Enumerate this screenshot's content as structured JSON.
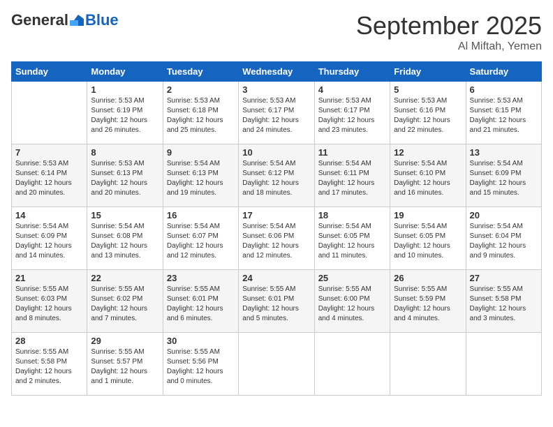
{
  "logo": {
    "general": "General",
    "blue": "Blue"
  },
  "header": {
    "month": "September 2025",
    "location": "Al Miftah, Yemen"
  },
  "weekdays": [
    "Sunday",
    "Monday",
    "Tuesday",
    "Wednesday",
    "Thursday",
    "Friday",
    "Saturday"
  ],
  "weeks": [
    [
      {
        "day": null
      },
      {
        "day": 1,
        "sunrise": "Sunrise: 5:53 AM",
        "sunset": "Sunset: 6:19 PM",
        "daylight": "Daylight: 12 hours and 26 minutes."
      },
      {
        "day": 2,
        "sunrise": "Sunrise: 5:53 AM",
        "sunset": "Sunset: 6:18 PM",
        "daylight": "Daylight: 12 hours and 25 minutes."
      },
      {
        "day": 3,
        "sunrise": "Sunrise: 5:53 AM",
        "sunset": "Sunset: 6:17 PM",
        "daylight": "Daylight: 12 hours and 24 minutes."
      },
      {
        "day": 4,
        "sunrise": "Sunrise: 5:53 AM",
        "sunset": "Sunset: 6:17 PM",
        "daylight": "Daylight: 12 hours and 23 minutes."
      },
      {
        "day": 5,
        "sunrise": "Sunrise: 5:53 AM",
        "sunset": "Sunset: 6:16 PM",
        "daylight": "Daylight: 12 hours and 22 minutes."
      },
      {
        "day": 6,
        "sunrise": "Sunrise: 5:53 AM",
        "sunset": "Sunset: 6:15 PM",
        "daylight": "Daylight: 12 hours and 21 minutes."
      }
    ],
    [
      {
        "day": 7,
        "sunrise": "Sunrise: 5:53 AM",
        "sunset": "Sunset: 6:14 PM",
        "daylight": "Daylight: 12 hours and 20 minutes."
      },
      {
        "day": 8,
        "sunrise": "Sunrise: 5:53 AM",
        "sunset": "Sunset: 6:13 PM",
        "daylight": "Daylight: 12 hours and 20 minutes."
      },
      {
        "day": 9,
        "sunrise": "Sunrise: 5:54 AM",
        "sunset": "Sunset: 6:13 PM",
        "daylight": "Daylight: 12 hours and 19 minutes."
      },
      {
        "day": 10,
        "sunrise": "Sunrise: 5:54 AM",
        "sunset": "Sunset: 6:12 PM",
        "daylight": "Daylight: 12 hours and 18 minutes."
      },
      {
        "day": 11,
        "sunrise": "Sunrise: 5:54 AM",
        "sunset": "Sunset: 6:11 PM",
        "daylight": "Daylight: 12 hours and 17 minutes."
      },
      {
        "day": 12,
        "sunrise": "Sunrise: 5:54 AM",
        "sunset": "Sunset: 6:10 PM",
        "daylight": "Daylight: 12 hours and 16 minutes."
      },
      {
        "day": 13,
        "sunrise": "Sunrise: 5:54 AM",
        "sunset": "Sunset: 6:09 PM",
        "daylight": "Daylight: 12 hours and 15 minutes."
      }
    ],
    [
      {
        "day": 14,
        "sunrise": "Sunrise: 5:54 AM",
        "sunset": "Sunset: 6:09 PM",
        "daylight": "Daylight: 12 hours and 14 minutes."
      },
      {
        "day": 15,
        "sunrise": "Sunrise: 5:54 AM",
        "sunset": "Sunset: 6:08 PM",
        "daylight": "Daylight: 12 hours and 13 minutes."
      },
      {
        "day": 16,
        "sunrise": "Sunrise: 5:54 AM",
        "sunset": "Sunset: 6:07 PM",
        "daylight": "Daylight: 12 hours and 12 minutes."
      },
      {
        "day": 17,
        "sunrise": "Sunrise: 5:54 AM",
        "sunset": "Sunset: 6:06 PM",
        "daylight": "Daylight: 12 hours and 12 minutes."
      },
      {
        "day": 18,
        "sunrise": "Sunrise: 5:54 AM",
        "sunset": "Sunset: 6:05 PM",
        "daylight": "Daylight: 12 hours and 11 minutes."
      },
      {
        "day": 19,
        "sunrise": "Sunrise: 5:54 AM",
        "sunset": "Sunset: 6:05 PM",
        "daylight": "Daylight: 12 hours and 10 minutes."
      },
      {
        "day": 20,
        "sunrise": "Sunrise: 5:54 AM",
        "sunset": "Sunset: 6:04 PM",
        "daylight": "Daylight: 12 hours and 9 minutes."
      }
    ],
    [
      {
        "day": 21,
        "sunrise": "Sunrise: 5:55 AM",
        "sunset": "Sunset: 6:03 PM",
        "daylight": "Daylight: 12 hours and 8 minutes."
      },
      {
        "day": 22,
        "sunrise": "Sunrise: 5:55 AM",
        "sunset": "Sunset: 6:02 PM",
        "daylight": "Daylight: 12 hours and 7 minutes."
      },
      {
        "day": 23,
        "sunrise": "Sunrise: 5:55 AM",
        "sunset": "Sunset: 6:01 PM",
        "daylight": "Daylight: 12 hours and 6 minutes."
      },
      {
        "day": 24,
        "sunrise": "Sunrise: 5:55 AM",
        "sunset": "Sunset: 6:01 PM",
        "daylight": "Daylight: 12 hours and 5 minutes."
      },
      {
        "day": 25,
        "sunrise": "Sunrise: 5:55 AM",
        "sunset": "Sunset: 6:00 PM",
        "daylight": "Daylight: 12 hours and 4 minutes."
      },
      {
        "day": 26,
        "sunrise": "Sunrise: 5:55 AM",
        "sunset": "Sunset: 5:59 PM",
        "daylight": "Daylight: 12 hours and 4 minutes."
      },
      {
        "day": 27,
        "sunrise": "Sunrise: 5:55 AM",
        "sunset": "Sunset: 5:58 PM",
        "daylight": "Daylight: 12 hours and 3 minutes."
      }
    ],
    [
      {
        "day": 28,
        "sunrise": "Sunrise: 5:55 AM",
        "sunset": "Sunset: 5:58 PM",
        "daylight": "Daylight: 12 hours and 2 minutes."
      },
      {
        "day": 29,
        "sunrise": "Sunrise: 5:55 AM",
        "sunset": "Sunset: 5:57 PM",
        "daylight": "Daylight: 12 hours and 1 minute."
      },
      {
        "day": 30,
        "sunrise": "Sunrise: 5:55 AM",
        "sunset": "Sunset: 5:56 PM",
        "daylight": "Daylight: 12 hours and 0 minutes."
      },
      {
        "day": null
      },
      {
        "day": null
      },
      {
        "day": null
      },
      {
        "day": null
      }
    ]
  ]
}
